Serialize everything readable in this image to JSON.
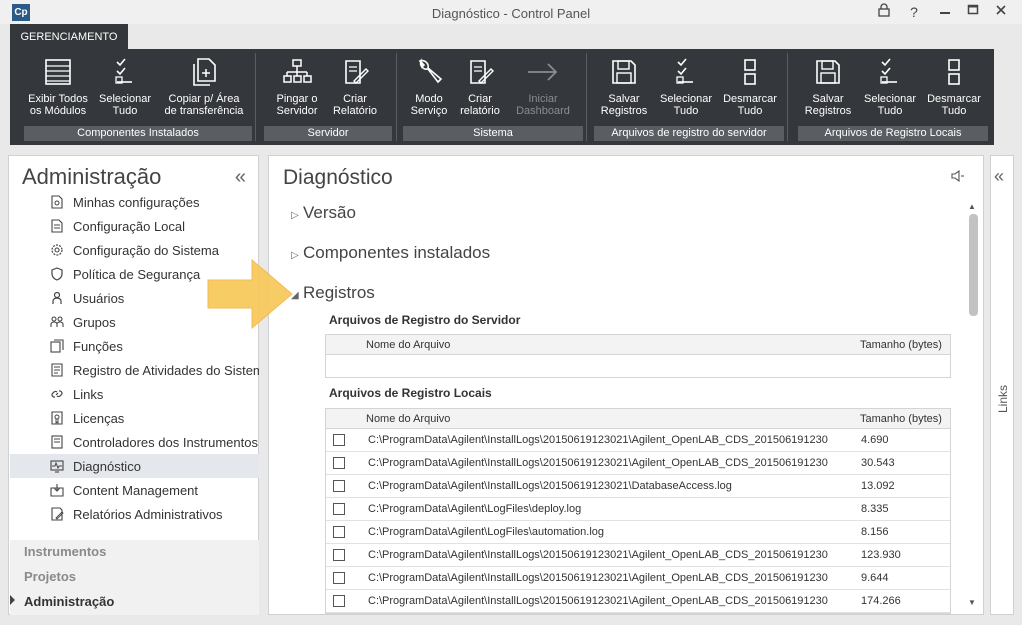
{
  "window": {
    "app_logo": "Cp",
    "title": "Diagnóstico - Control Panel",
    "controls": [
      "lock-icon",
      "help-icon",
      "minimize-icon",
      "maximize-icon",
      "close-icon"
    ]
  },
  "ribbon": {
    "tab": "GERENCIAMENTO",
    "groups": [
      {
        "label": "Componentes Instalados",
        "buttons": [
          {
            "line1": "Exibir Todos",
            "line2": "os Módulos",
            "icon": "list-icon"
          },
          {
            "line1": "Selecionar",
            "line2": "Tudo",
            "icon": "checklist-icon"
          },
          {
            "line1": "Copiar p/ Área",
            "line2": "de transferência",
            "icon": "copy-icon"
          }
        ]
      },
      {
        "label": "Servidor",
        "buttons": [
          {
            "line1": "Pingar o",
            "line2": "Servidor",
            "icon": "network-icon"
          },
          {
            "line1": "Criar",
            "line2": "Relatório",
            "icon": "report-icon"
          }
        ]
      },
      {
        "label": "Sistema",
        "buttons": [
          {
            "line1": "Modo",
            "line2": "Serviço",
            "icon": "wrench-icon"
          },
          {
            "line1": "Criar",
            "line2": "relatório",
            "icon": "report-icon"
          },
          {
            "line1": "Iniciar",
            "line2": "Dashboard",
            "icon": "arrow-right-icon",
            "disabled": true
          }
        ]
      },
      {
        "label": "Arquivos de registro do servidor",
        "buttons": [
          {
            "line1": "Salvar",
            "line2": "Registros",
            "icon": "save-icon"
          },
          {
            "line1": "Selecionar",
            "line2": "Tudo",
            "icon": "checklist-icon"
          },
          {
            "line1": "Desmarcar",
            "line2": "Tudo",
            "icon": "uncheck-icon"
          }
        ]
      },
      {
        "label": "Arquivos de Registro Locais",
        "buttons": [
          {
            "line1": "Salvar",
            "line2": "Registros",
            "icon": "save-icon"
          },
          {
            "line1": "Selecionar",
            "line2": "Tudo",
            "icon": "checklist-icon"
          },
          {
            "line1": "Desmarcar",
            "line2": "Tudo",
            "icon": "uncheck-icon"
          }
        ]
      }
    ]
  },
  "sidebar": {
    "title": "Administração",
    "collapse_glyph": "«",
    "items": [
      {
        "label": "Minhas configurações",
        "icon": "settings-doc-icon"
      },
      {
        "label": "Configuração Local",
        "icon": "local-config-icon"
      },
      {
        "label": "Configuração do Sistema",
        "icon": "gear-icon"
      },
      {
        "label": "Política de Segurança",
        "icon": "shield-icon"
      },
      {
        "label": "Usuários",
        "icon": "user-icon"
      },
      {
        "label": "Grupos",
        "icon": "group-icon"
      },
      {
        "label": "Funções",
        "icon": "roles-icon"
      },
      {
        "label": "Registro de Atividades do Sistema",
        "icon": "activity-log-icon"
      },
      {
        "label": "Links",
        "icon": "link-icon"
      },
      {
        "label": "Licenças",
        "icon": "license-icon"
      },
      {
        "label": "Controladores dos Instrumentos",
        "icon": "controller-icon"
      },
      {
        "label": "Diagnóstico",
        "icon": "diagnostic-icon",
        "selected": true
      },
      {
        "label": "Content Management",
        "icon": "content-icon"
      },
      {
        "label": "Relatórios Administrativos",
        "icon": "admin-report-icon"
      }
    ],
    "bottom_nav": [
      {
        "label": "Instrumentos"
      },
      {
        "label": "Projetos"
      },
      {
        "label": "Administração",
        "active": true
      }
    ]
  },
  "main": {
    "title": "Diagnóstico",
    "sections": [
      {
        "label": "Versão",
        "expanded": false
      },
      {
        "label": "Componentes instalados",
        "expanded": false
      },
      {
        "label": "Registros",
        "expanded": true
      }
    ],
    "server_logs": {
      "title": "Arquivos de Registro do Servidor",
      "col_name": "Nome do Arquivo",
      "col_size": "Tamanho (bytes)",
      "rows": []
    },
    "local_logs": {
      "title": "Arquivos de Registro Locais",
      "col_name": "Nome do Arquivo",
      "col_size": "Tamanho (bytes)",
      "rows": [
        {
          "name": "C:\\ProgramData\\Agilent\\InstallLogs\\20150619123021\\Agilent_OpenLAB_CDS_201506191230",
          "size": "4.690"
        },
        {
          "name": "C:\\ProgramData\\Agilent\\InstallLogs\\20150619123021\\Agilent_OpenLAB_CDS_201506191230",
          "size": "30.543"
        },
        {
          "name": "C:\\ProgramData\\Agilent\\InstallLogs\\20150619123021\\DatabaseAccess.log",
          "size": "13.092"
        },
        {
          "name": "C:\\ProgramData\\Agilent\\LogFiles\\deploy.log",
          "size": "8.335"
        },
        {
          "name": "C:\\ProgramData\\Agilent\\LogFiles\\automation.log",
          "size": "8.156"
        },
        {
          "name": "C:\\ProgramData\\Agilent\\InstallLogs\\20150619123021\\Agilent_OpenLAB_CDS_201506191230",
          "size": "123.930"
        },
        {
          "name": "C:\\ProgramData\\Agilent\\InstallLogs\\20150619123021\\Agilent_OpenLAB_CDS_201506191230",
          "size": "9.644"
        },
        {
          "name": "C:\\ProgramData\\Agilent\\InstallLogs\\20150619123021\\Agilent_OpenLAB_CDS_201506191230",
          "size": "174.266"
        }
      ]
    }
  },
  "right_panel": {
    "collapse_glyph": "«",
    "label": "Links"
  },
  "colors": {
    "ribbon_bg": "#34373b",
    "ribbon_group_label": "#5a5d62",
    "selected_item": "#e4e8ec",
    "callout_arrow": "#f8c859"
  }
}
